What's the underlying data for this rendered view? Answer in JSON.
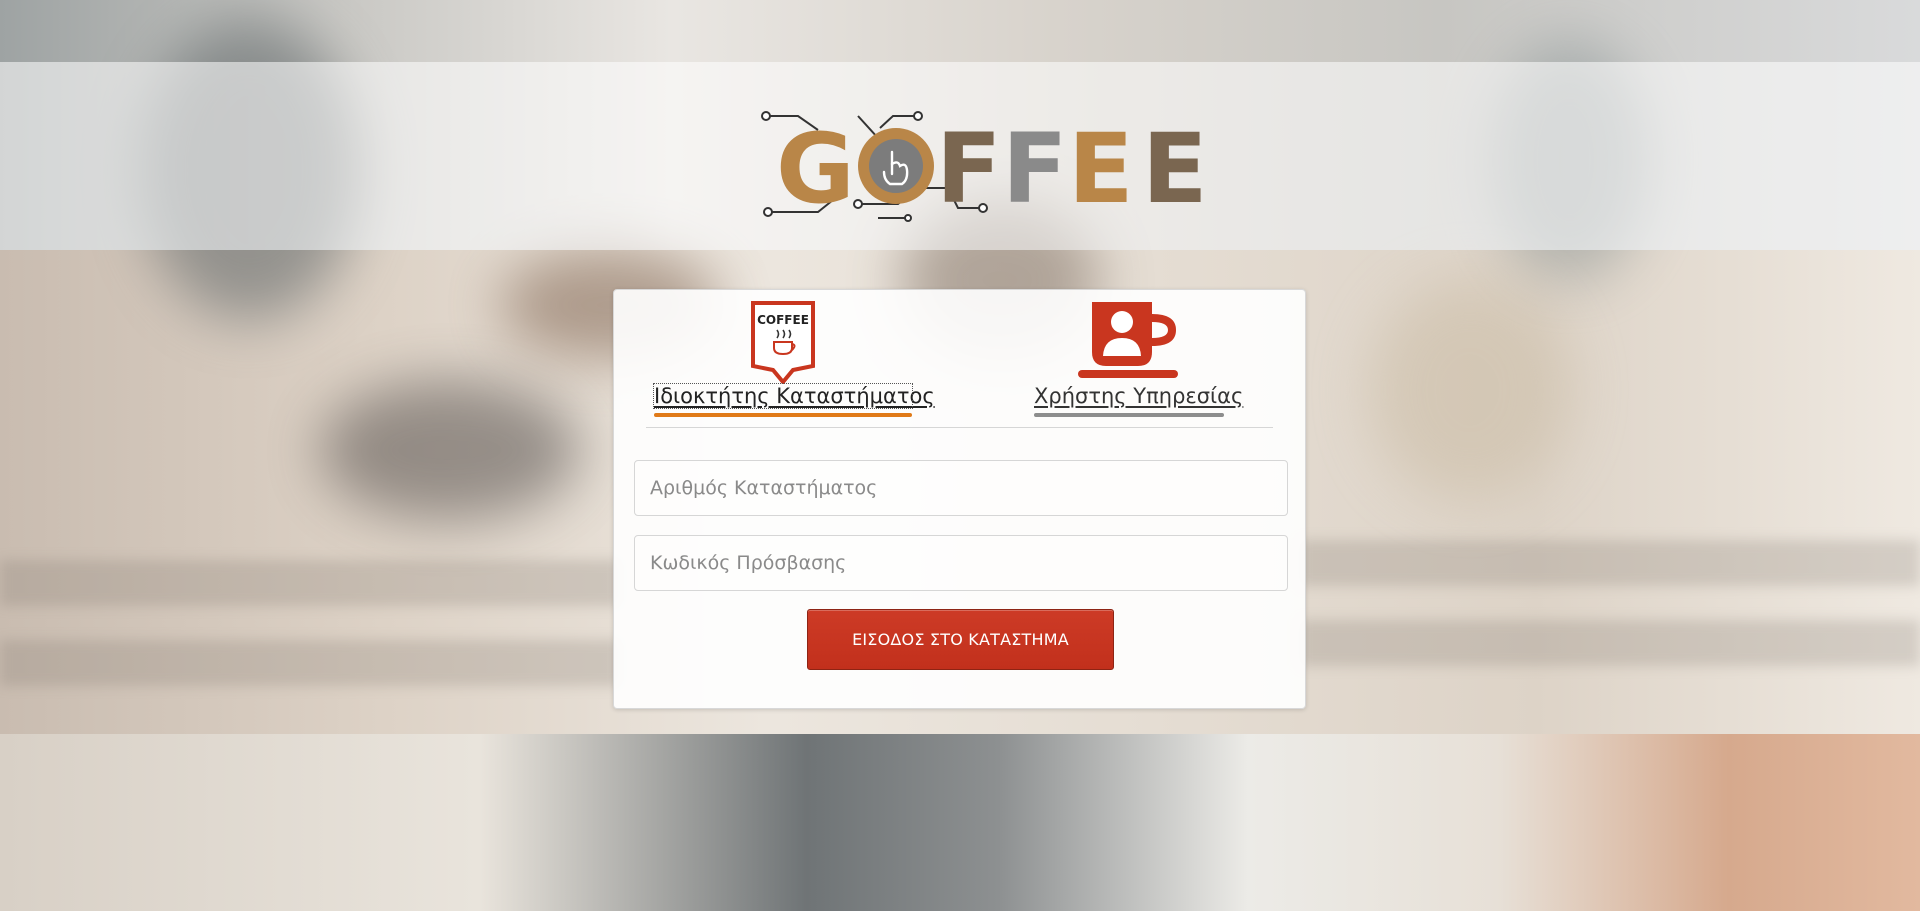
{
  "brand": {
    "logo_text": "GOFFEE",
    "colors": {
      "gold": "#b98648",
      "brown": "#7a6650",
      "grey": "#8a8a8a",
      "accent": "#c9361f"
    }
  },
  "tabs": [
    {
      "label": "Ιδιοκτήτης Καταστήματος",
      "icon": "coffee-shop-badge-icon",
      "active": true,
      "underline_color": "#e07a18"
    },
    {
      "label": "Χρήστης Υπηρεσίας",
      "icon": "user-cup-icon",
      "active": false,
      "underline_color": "#8d8d8d"
    }
  ],
  "form": {
    "store_number_placeholder": "Αριθμός Καταστήματος",
    "password_placeholder": "Κωδικός Πρόσβασης",
    "submit_label": "ΕΙΣΟΔΟΣ ΣΤΟ ΚΑΤΑΣΤΗΜΑ"
  },
  "icons": {
    "owner_badge_text": "COFFEE"
  }
}
